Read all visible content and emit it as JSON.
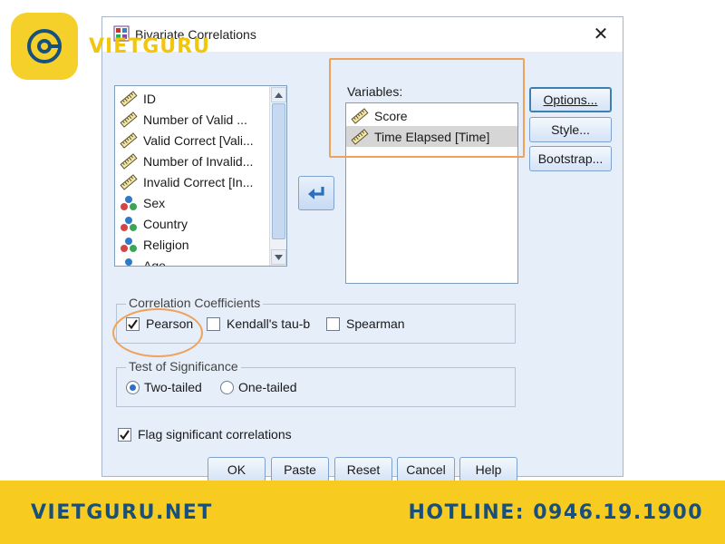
{
  "brand": {
    "logo_text": "VIETGURU",
    "footer_left": "VIETGURU.NET",
    "footer_right": "HOTLINE: 0946.19.1900",
    "color_yellow": "#f7cb1f",
    "color_blue": "#17507f"
  },
  "dialog": {
    "title": "Bivariate Correlations",
    "close_symbol": "✕",
    "source_variables": [
      {
        "label": "ID",
        "icon": "ruler-scale-icon"
      },
      {
        "label": "Number of Valid ...",
        "icon": "ruler-scale-icon"
      },
      {
        "label": "Valid Correct [Vali...",
        "icon": "ruler-scale-icon"
      },
      {
        "label": "Number of Invalid...",
        "icon": "ruler-scale-icon"
      },
      {
        "label": "Invalid Correct [In...",
        "icon": "ruler-scale-icon"
      },
      {
        "label": "Sex",
        "icon": "nominal-icon"
      },
      {
        "label": "Country",
        "icon": "nominal-icon"
      },
      {
        "label": "Religion",
        "icon": "nominal-icon"
      },
      {
        "label": "Age",
        "icon": "nominal-icon"
      }
    ],
    "variables_label": "Variables:",
    "target_variables": [
      {
        "label": "Score",
        "icon": "ruler-scale-icon",
        "selected": false
      },
      {
        "label": "Time Elapsed [Time]",
        "icon": "ruler-scale-icon",
        "selected": true
      }
    ],
    "side_buttons": {
      "options": "Options...",
      "style": "Style...",
      "bootstrap": "Bootstrap..."
    },
    "correlation": {
      "title": "Correlation Coefficients",
      "pearson": "Pearson",
      "pearson_checked": true,
      "kendall": "Kendall's tau-b",
      "kendall_checked": false,
      "spearman": "Spearman",
      "spearman_checked": false
    },
    "significance": {
      "title": "Test of Significance",
      "two_tailed": "Two-tailed",
      "one_tailed": "One-tailed",
      "selected": "two_tailed"
    },
    "flag": {
      "label": "Flag significant correlations",
      "checked": true
    },
    "buttons": {
      "ok": "OK",
      "paste": "Paste",
      "reset": "Reset",
      "cancel": "Cancel",
      "help": "Help"
    },
    "highlight_color": "#f0a25a"
  }
}
